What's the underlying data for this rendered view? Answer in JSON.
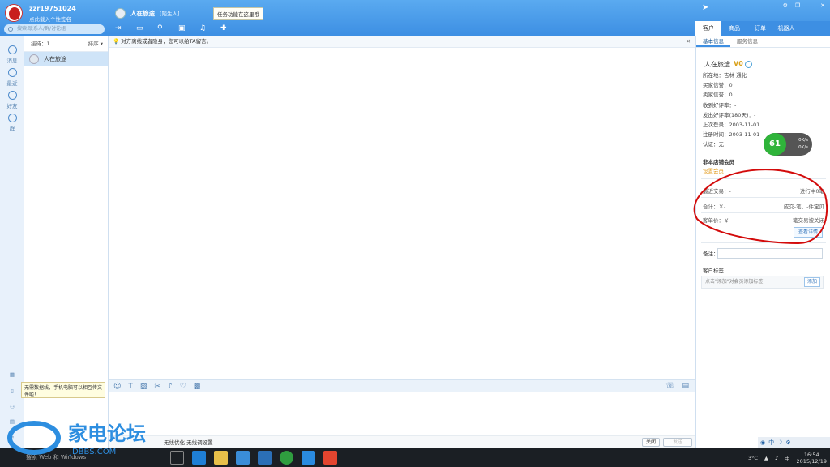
{
  "profile": {
    "username": "zzr19751024",
    "signature": "点此载入个性签名",
    "search_placeholder": "搜索:联系人/群/讨论组"
  },
  "chat": {
    "contact_name": "人在旅途",
    "contact_tag": "[陌生人]",
    "tooltip": "任务功能在这里哦",
    "notice": "对方离线或者隐身，您可以给TA留言。"
  },
  "right_tabs": [
    "客户",
    "商品",
    "订单",
    "机器人"
  ],
  "left_nav": [
    {
      "label": "消息",
      "icon": "message-icon"
    },
    {
      "label": "最近",
      "icon": "clock-icon"
    },
    {
      "label": "好友",
      "icon": "friend-icon"
    },
    {
      "label": "群",
      "icon": "group-icon"
    }
  ],
  "session": {
    "header_left": "接待：1",
    "header_right": "排序",
    "item_name": "人在旅途"
  },
  "input": {
    "tip": "无需数据线，手机电脑可以相互传文件啦！",
    "status": "无线优化 无线调设置",
    "close_label": "关闭",
    "send_label": "发送"
  },
  "customer": {
    "subtabs": [
      "基本信息",
      "服务信息"
    ],
    "name": "人在旅途",
    "vip": "V0",
    "fields": [
      "所在地：吉林 通化",
      "买家信誉：0",
      "卖家信誉：0",
      "收到好评率：-",
      "发出好评率(180天)：-",
      "上次登录：2003-11-01",
      "注册时间：2003-11-01",
      "认证：无"
    ],
    "member_title": "非本店铺会员",
    "member_sub": "设置会员",
    "recent_trade": "最近交易：-",
    "in_progress": "进行中0笔",
    "total": "合计：￥-",
    "deal": "成交-笔，-件宝贝",
    "avg": "客单价：￥-",
    "closed": "-笔交易被关闭",
    "detail_btn": "查看详情",
    "memo_label": "备注：",
    "tag_title": "客户标签",
    "tag_hint": "点击\"添加\"对会员添加标签",
    "tag_add": "添加"
  },
  "speed": {
    "percent": "61",
    "up": "0K/s",
    "down": "0K/s"
  },
  "taskbar": {
    "search": "搜索 Web 和 Windows",
    "temp": "3°C",
    "time": "16:54",
    "date": "2015/12/19",
    "ime": "中"
  },
  "watermark": {
    "title": "家电论坛",
    "url": "JDBBS.COM"
  }
}
